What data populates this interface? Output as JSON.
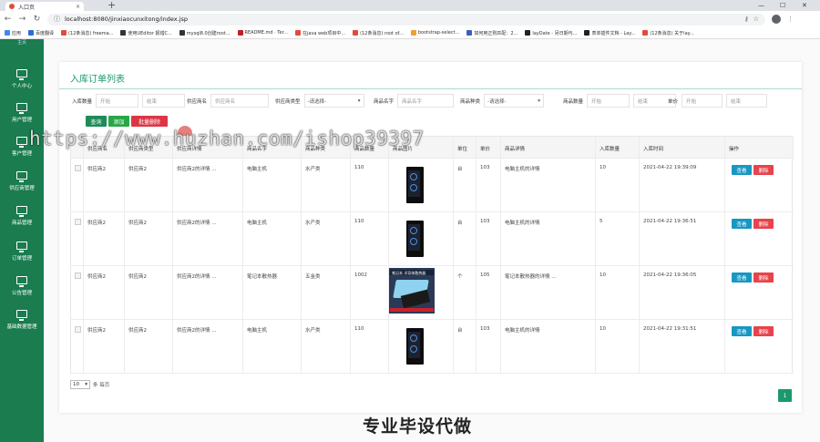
{
  "browser": {
    "tab_title": "入口页",
    "tab_close": "×",
    "new_tab": "+",
    "url": "localhost:8080/jinxiaocunxitong/index.jsp",
    "win_min": "—",
    "win_max": "☐",
    "win_close": "✕"
  },
  "bookmarks": [
    {
      "label": "应用",
      "color": "#4285f4"
    },
    {
      "label": "百度翻译",
      "color": "#2b6de0"
    },
    {
      "label": "(12条消息) freema...",
      "color": "#e14c3a"
    },
    {
      "label": "使用UEditor 报错C...",
      "color": "#333333"
    },
    {
      "label": "mysql8.0创建root...",
      "color": "#333333"
    },
    {
      "label": "README.md · Ter...",
      "color": "#c71d23"
    },
    {
      "label": "在java web项目中...",
      "color": "#e14c3a"
    },
    {
      "label": "(12条消息) root of...",
      "color": "#e14c3a"
    },
    {
      "label": "bootstrap-select...",
      "color": "#f0a030"
    },
    {
      "label": "如何用正则匹配：2...",
      "color": "#3b5fc0"
    },
    {
      "label": "layDate - 另日期与...",
      "color": "#222222"
    },
    {
      "label": "表单插件文档 - Lay...",
      "color": "#222222"
    },
    {
      "label": "(12条消息) 关于lay...",
      "color": "#e14c3a"
    }
  ],
  "sidebar": {
    "top_label": "主页",
    "items": [
      "个人中心",
      "用户管理",
      "客户管理",
      "供应商管理",
      "商品管理",
      "订单管理",
      "公告管理",
      "基础数据管理"
    ]
  },
  "page": {
    "title": "入库订单列表"
  },
  "filters": {
    "quantity_label": "入库数量",
    "start_placeholder": "开始",
    "end_placeholder": "结束",
    "supplier_label": "供应商名",
    "supplier_placeholder": "供应商名",
    "supplier_type_label": "供应商类型",
    "select_placeholder": "-请选择-",
    "product_name_label": "商品名字",
    "product_name_placeholder": "商品名字",
    "product_type_label": "商品种类",
    "product_qty_label": "商品数量",
    "price_label": "单价"
  },
  "actions": {
    "query": "查询",
    "add": "添加",
    "batch_delete": "批量删除"
  },
  "table": {
    "headers": [
      "",
      "供应商名",
      "供应商类型",
      "供应商详情",
      "商品名字",
      "商品种类",
      "商品数量",
      "商品图片",
      "单位",
      "单价",
      "商品详情",
      "入库数量",
      "入库时间",
      "操作"
    ],
    "rows": [
      {
        "supplier": "供应商2",
        "supplier_type": "供应商2",
        "supplier_detail": "供应商2的详情 ...",
        "product": "电脑主机",
        "category": "水产类",
        "stock": "110",
        "image": "pc",
        "unit": "台",
        "price": "103",
        "detail": "电脑主机的详情",
        "in_qty": "10",
        "in_time": "2021-04-22 19:39:09"
      },
      {
        "supplier": "供应商2",
        "supplier_type": "供应商2",
        "supplier_detail": "供应商2的详情 ...",
        "product": "电脑主机",
        "category": "水产类",
        "stock": "110",
        "image": "pc",
        "unit": "台",
        "price": "103",
        "detail": "电脑主机的详情",
        "in_qty": "5",
        "in_time": "2021-04-22 19:36:51"
      },
      {
        "supplier": "供应商2",
        "supplier_type": "供应商2",
        "supplier_detail": "供应商2的详情 ...",
        "product": "笔记本散热器",
        "category": "五金类",
        "stock": "1002",
        "image": "cooler",
        "unit": "个",
        "price": "105",
        "detail": "笔记本散热器的详情 ...",
        "in_qty": "10",
        "in_time": "2021-04-22 19:36:05"
      },
      {
        "supplier": "供应商2",
        "supplier_type": "供应商2",
        "supplier_detail": "供应商2的详情 ...",
        "product": "电脑主机",
        "category": "水产类",
        "stock": "110",
        "image": "pc",
        "unit": "台",
        "price": "103",
        "detail": "电脑主机的详情",
        "in_qty": "10",
        "in_time": "2021-04-22 19:31:51"
      }
    ],
    "view_label": "查看",
    "delete_label": "删除",
    "cooler_banner": "笔记本 半导体散热器"
  },
  "pagination": {
    "page_size": "10",
    "per_page_text": "条 每页",
    "current_page": "1"
  },
  "overlay": {
    "watermark": "https://www.huzhan.com/ishop39397",
    "caption": "专业毕设代做"
  }
}
